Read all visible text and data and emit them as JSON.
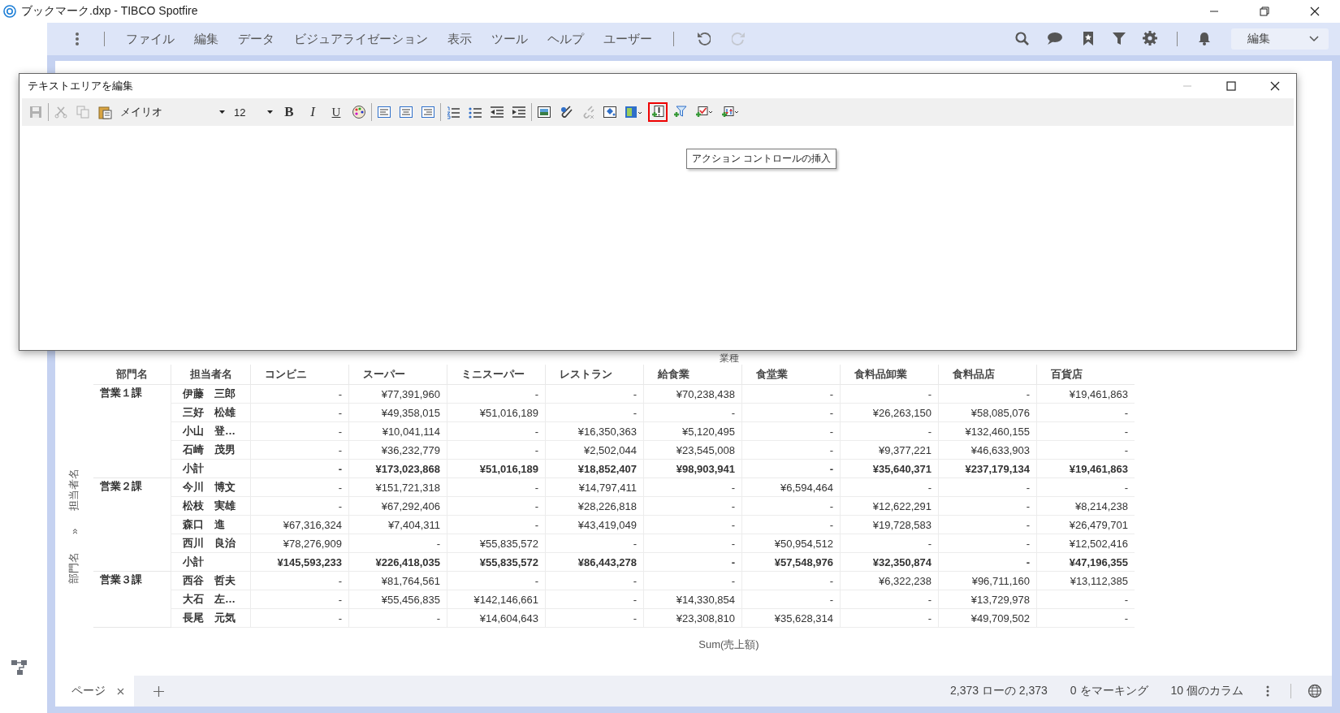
{
  "window": {
    "title": "ブックマーク.dxp - TIBCO Spotfire"
  },
  "menu_bar": {
    "menus": [
      "ファイル",
      "編集",
      "データ",
      "ビジュアライゼーション",
      "表示",
      "ツール",
      "ヘルプ",
      "ユーザー"
    ],
    "history": [
      {
        "kind": "undo",
        "disabled": false
      },
      {
        "kind": "redo",
        "disabled": true
      }
    ],
    "tools": [
      {
        "kind": "search"
      },
      {
        "kind": "chat"
      },
      {
        "kind": "bookmark"
      },
      {
        "kind": "filter"
      },
      {
        "kind": "settings"
      },
      {
        "kind": "bell"
      }
    ],
    "mode": "編集"
  },
  "dialog": {
    "title": "テキストエリアを編集",
    "toolbar": [
      {
        "kind": "save",
        "disabled": true,
        "highlighted": false
      },
      {
        "kind": "separator"
      },
      {
        "kind": "cut",
        "disabled": true,
        "highlighted": false
      },
      {
        "kind": "copy",
        "disabled": true,
        "highlighted": false
      },
      {
        "kind": "paste",
        "disabled": false,
        "highlighted": false
      },
      {
        "kind": "font",
        "value": "メイリオ"
      },
      {
        "kind": "size",
        "value": "12"
      },
      {
        "kind": "bold",
        "label": "B",
        "disabled": false,
        "highlighted": false
      },
      {
        "kind": "italic",
        "label": "I",
        "disabled": false,
        "highlighted": false
      },
      {
        "kind": "underline",
        "label": "U",
        "disabled": false,
        "highlighted": false
      },
      {
        "kind": "palette",
        "disabled": false,
        "highlighted": false
      },
      {
        "kind": "separator"
      },
      {
        "kind": "align-left",
        "disabled": false,
        "highlighted": false
      },
      {
        "kind": "align-center",
        "disabled": false,
        "highlighted": false
      },
      {
        "kind": "align-right",
        "disabled": false,
        "highlighted": false
      },
      {
        "kind": "separator"
      },
      {
        "kind": "ordered-list",
        "disabled": false,
        "highlighted": false
      },
      {
        "kind": "bullet-list",
        "disabled": false,
        "highlighted": false
      },
      {
        "kind": "outdent",
        "disabled": false,
        "highlighted": false
      },
      {
        "kind": "indent",
        "disabled": false,
        "highlighted": false
      },
      {
        "kind": "separator"
      },
      {
        "kind": "image",
        "disabled": false,
        "highlighted": false
      },
      {
        "kind": "link",
        "disabled": false,
        "highlighted": false
      },
      {
        "kind": "unlink",
        "disabled": true,
        "highlighted": false
      },
      {
        "kind": "fill",
        "disabled": false,
        "highlighted": false
      },
      {
        "kind": "layout",
        "disabled": false,
        "highlighted": false
      },
      {
        "kind": "action",
        "disabled": false,
        "highlighted": true
      },
      {
        "kind": "filter",
        "disabled": false,
        "highlighted": false
      },
      {
        "kind": "property",
        "disabled": false,
        "highlighted": false
      },
      {
        "kind": "more",
        "disabled": false,
        "highlighted": false
      }
    ],
    "tooltip": "アクション コントロールの挿入"
  },
  "cross_table": {
    "column_axis": "業種",
    "row_axis": [
      "部門名",
      "»",
      "担当者名"
    ],
    "columns": [
      "部門名",
      "担当者名",
      "コンビニ",
      "スーパー",
      "ミニスーパー",
      "レストラン",
      "給食業",
      "食堂業",
      "食料品卸業",
      "食料品店",
      "百貨店"
    ],
    "groups": [
      {
        "name": "営業１課",
        "rows": [
          {
            "kind": "person",
            "name": "伊藤　三郎",
            "values": [
              "-",
              "¥77,391,960",
              "-",
              "-",
              "¥70,238,438",
              "-",
              "-",
              "-",
              "¥19,461,863"
            ]
          },
          {
            "kind": "person",
            "name": "三好　松雄",
            "values": [
              "-",
              "¥49,358,015",
              "¥51,016,189",
              "-",
              "-",
              "-",
              "¥26,263,150",
              "¥58,085,076",
              "-"
            ]
          },
          {
            "kind": "person",
            "name": "小山　登…",
            "values": [
              "-",
              "¥10,041,114",
              "-",
              "¥16,350,363",
              "¥5,120,495",
              "-",
              "-",
              "¥132,460,155",
              "-"
            ]
          },
          {
            "kind": "person",
            "name": "石崎　茂男",
            "values": [
              "-",
              "¥36,232,779",
              "-",
              "¥2,502,044",
              "¥23,545,008",
              "-",
              "¥9,377,221",
              "¥46,633,903",
              "-"
            ]
          },
          {
            "kind": "subtotal",
            "name": "小計",
            "values": [
              "-",
              "¥173,023,868",
              "¥51,016,189",
              "¥18,852,407",
              "¥98,903,941",
              "-",
              "¥35,640,371",
              "¥237,179,134",
              "¥19,461,863"
            ]
          }
        ]
      },
      {
        "name": "営業２課",
        "rows": [
          {
            "kind": "person",
            "name": "今川　博文",
            "values": [
              "-",
              "¥151,721,318",
              "-",
              "¥14,797,411",
              "-",
              "¥6,594,464",
              "-",
              "-",
              "-"
            ]
          },
          {
            "kind": "person",
            "name": "松枝　実雄",
            "values": [
              "-",
              "¥67,292,406",
              "-",
              "¥28,226,818",
              "-",
              "-",
              "¥12,622,291",
              "-",
              "¥8,214,238"
            ]
          },
          {
            "kind": "person",
            "name": "森口　進",
            "values": [
              "¥67,316,324",
              "¥7,404,311",
              "-",
              "¥43,419,049",
              "-",
              "-",
              "¥19,728,583",
              "-",
              "¥26,479,701"
            ]
          },
          {
            "kind": "person",
            "name": "西川　良治",
            "values": [
              "¥78,276,909",
              "-",
              "¥55,835,572",
              "-",
              "-",
              "¥50,954,512",
              "-",
              "-",
              "¥12,502,416"
            ]
          },
          {
            "kind": "subtotal",
            "name": "小計",
            "values": [
              "¥145,593,233",
              "¥226,418,035",
              "¥55,835,572",
              "¥86,443,278",
              "-",
              "¥57,548,976",
              "¥32,350,874",
              "-",
              "¥47,196,355"
            ]
          }
        ]
      },
      {
        "name": "営業３課",
        "rows": [
          {
            "kind": "person",
            "name": "西谷　哲夫",
            "values": [
              "-",
              "¥81,764,561",
              "-",
              "-",
              "-",
              "-",
              "¥6,322,238",
              "¥96,711,160",
              "¥13,112,385"
            ]
          },
          {
            "kind": "person",
            "name": "大石　左…",
            "values": [
              "-",
              "¥55,456,835",
              "¥142,146,661",
              "-",
              "¥14,330,854",
              "-",
              "-",
              "¥13,729,978",
              "-"
            ]
          },
          {
            "kind": "person",
            "name": "長尾　元気",
            "values": [
              "-",
              "-",
              "¥14,604,643",
              "-",
              "¥23,308,810",
              "¥35,628,314",
              "-",
              "¥49,709,502",
              "-"
            ]
          }
        ]
      }
    ],
    "measure": "Sum(売上額)"
  },
  "status_bar": {
    "tabs": [
      {
        "label": "ページ",
        "selected": true
      }
    ],
    "row_count": "2,373 ローの 2,373",
    "marked": "0 をマーキング",
    "columns": "10 個のカラム"
  }
}
